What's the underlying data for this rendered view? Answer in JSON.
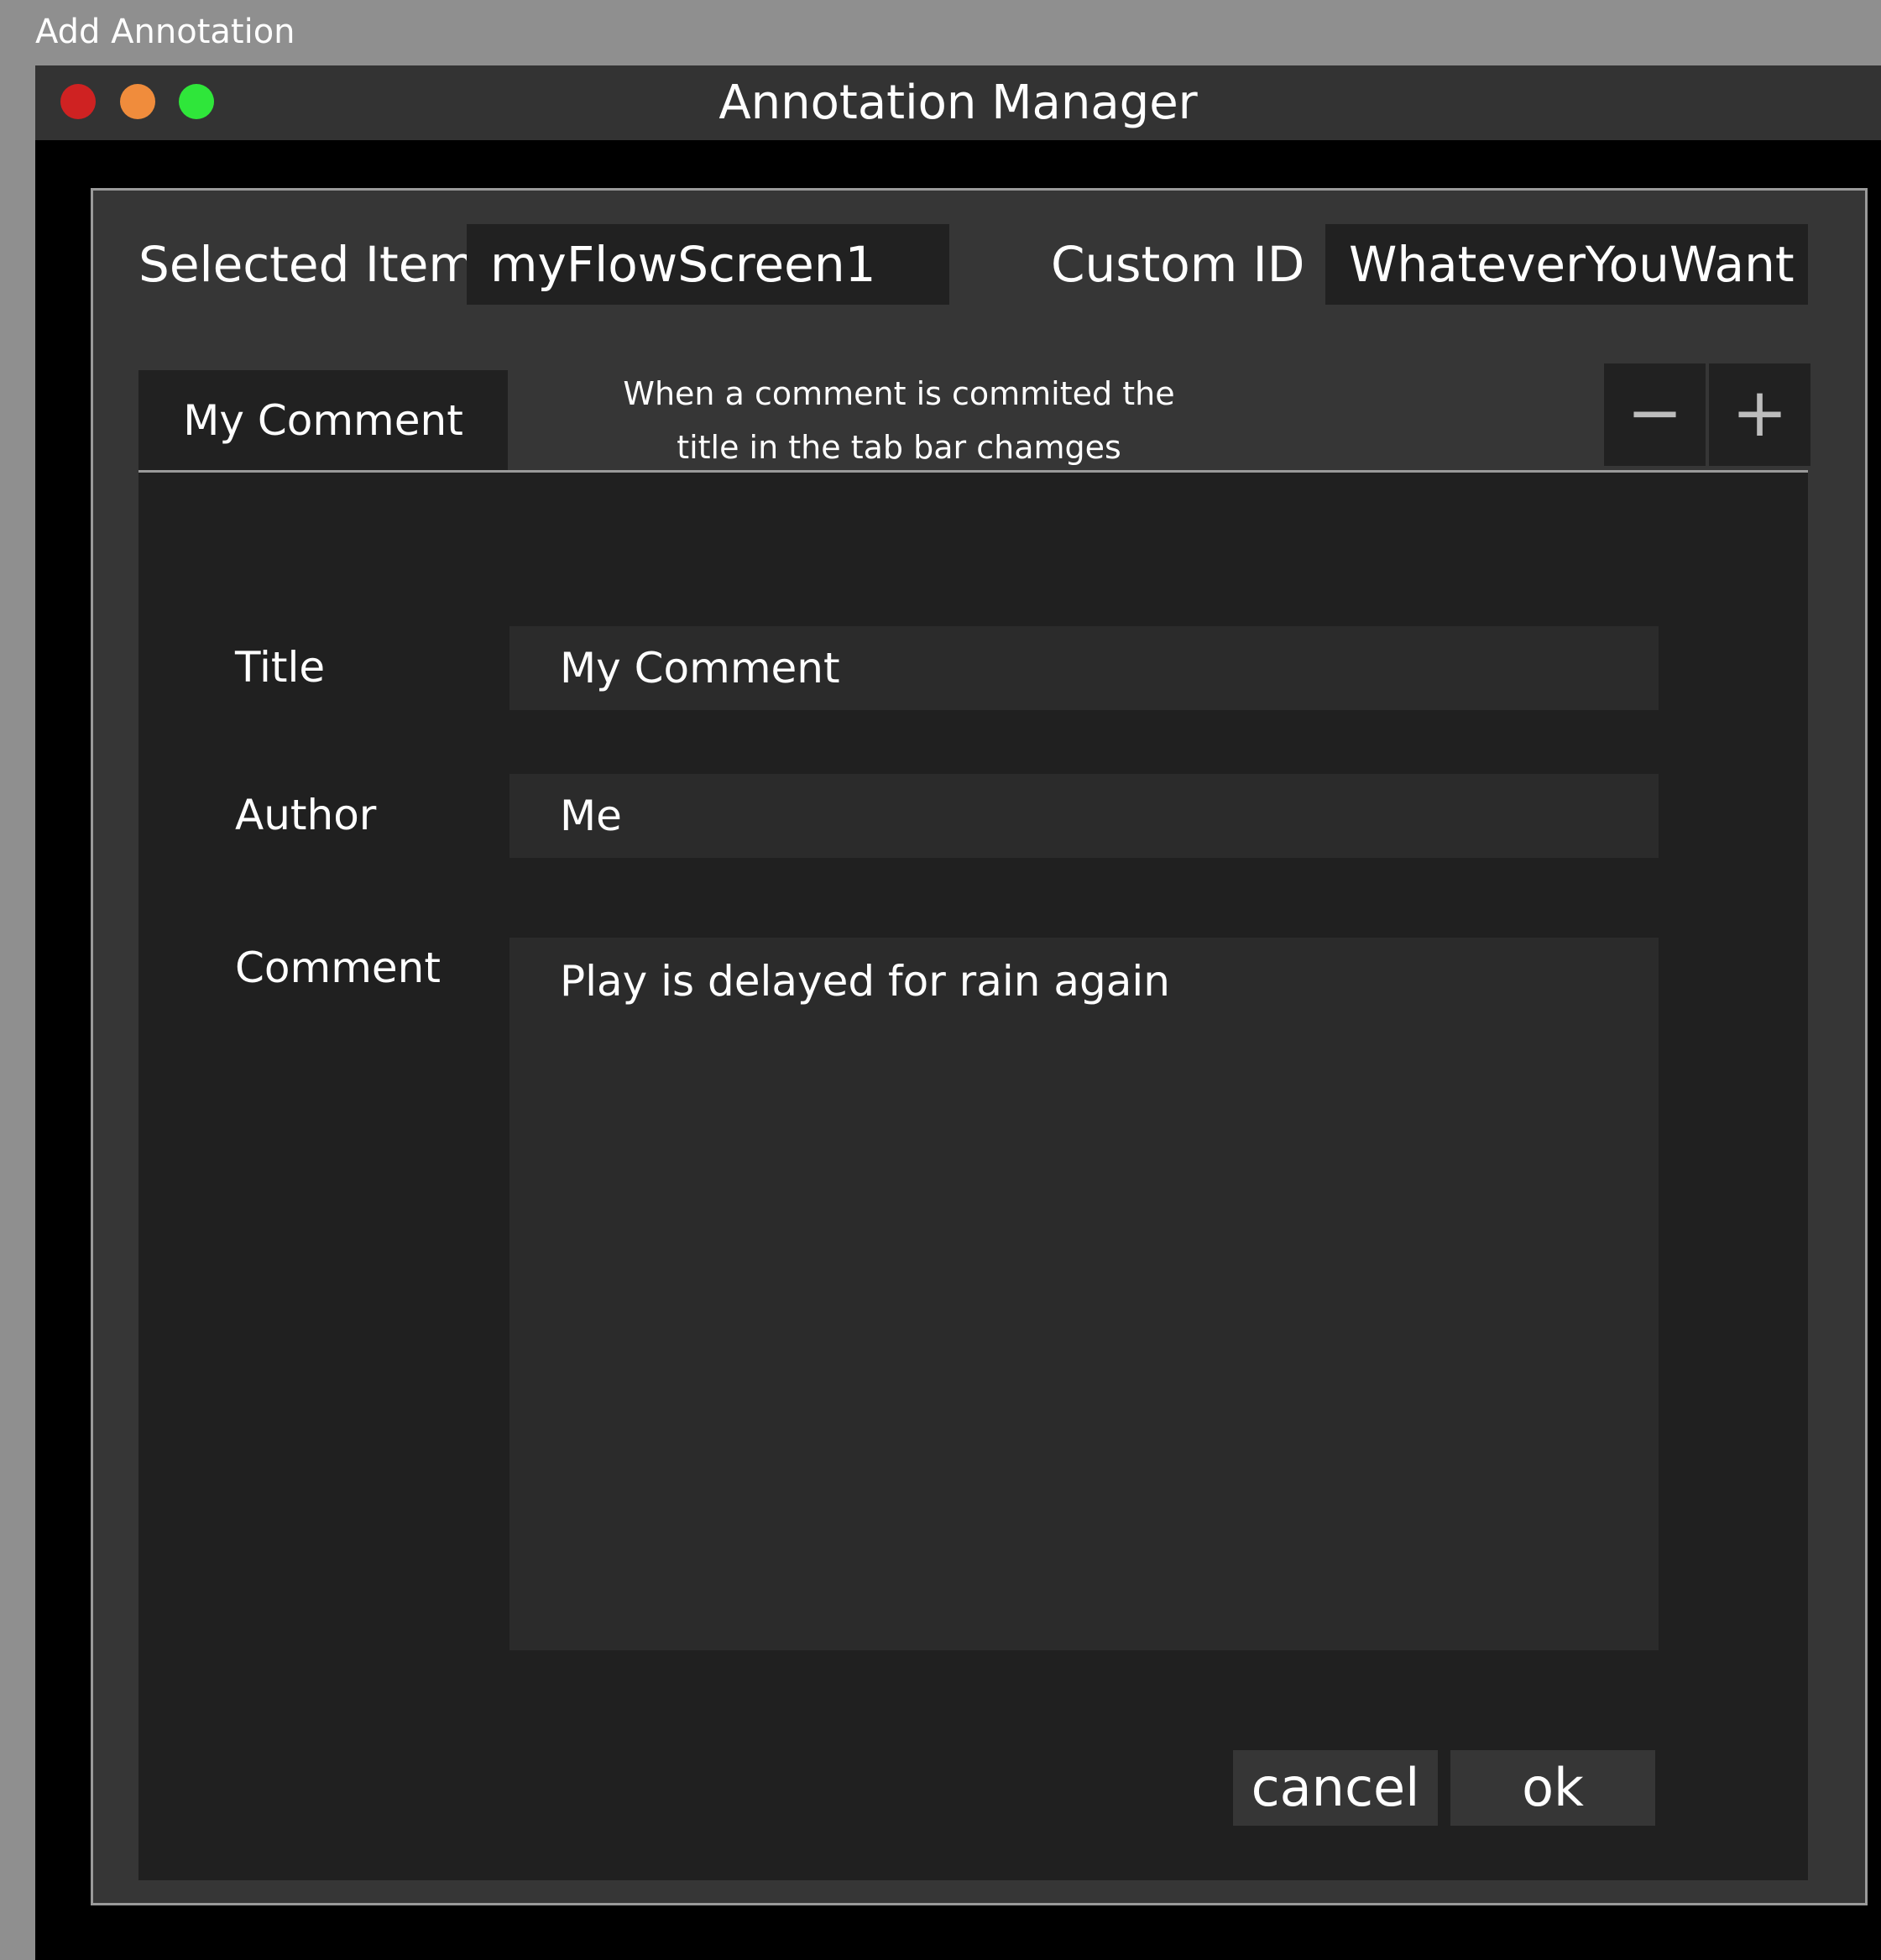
{
  "caption": "Add Annotation",
  "window": {
    "title": "Annotation Manager",
    "controls": {
      "close_color": "#cf2222",
      "minimize_color": "#f08c3c",
      "maximize_color": "#2fe63a"
    }
  },
  "header": {
    "selected_item_label": "Selected Item",
    "selected_item_value": "myFlowScreen1",
    "custom_id_label": "Custom ID",
    "custom_id_value": "WhateverYouWant"
  },
  "tabs": {
    "items": [
      {
        "label": "My Comment"
      }
    ],
    "note_line1": "When a comment is commited the",
    "note_line2": "title in the tab bar chamges",
    "remove_label": "−",
    "add_label": "+"
  },
  "form": {
    "title_label": "Title",
    "title_value": "My Comment",
    "author_label": "Author",
    "author_value": "Me",
    "comment_label": "Comment",
    "comment_value": "Play is delayed for rain again"
  },
  "actions": {
    "cancel_label": "cancel",
    "ok_label": "ok"
  }
}
